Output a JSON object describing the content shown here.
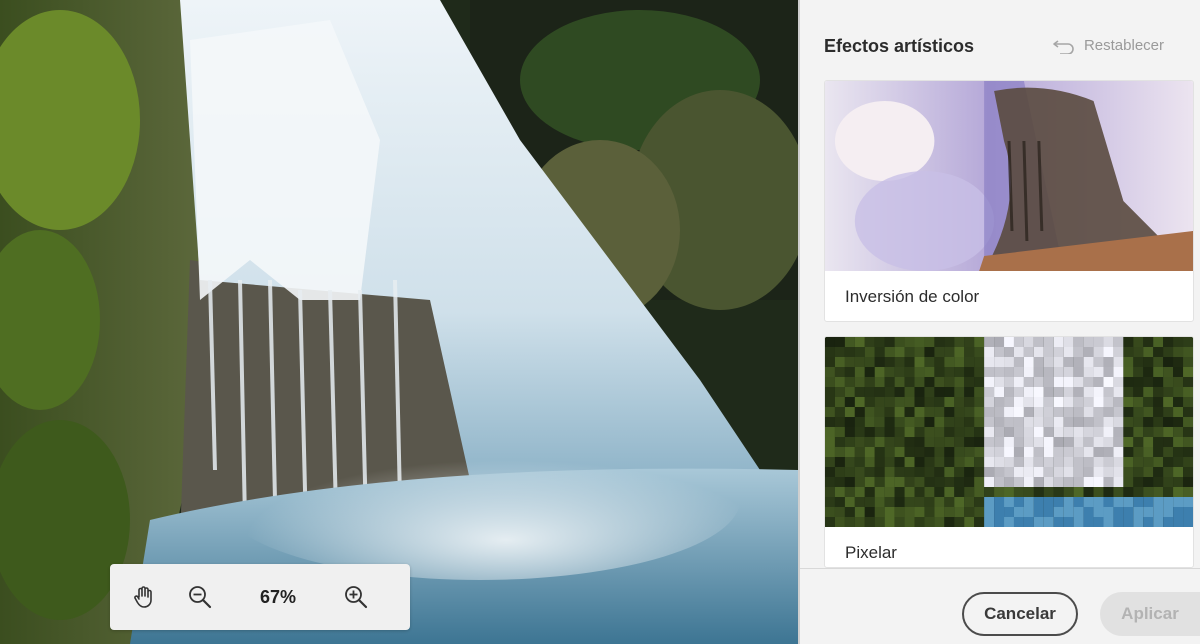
{
  "panel": {
    "title": "Efectos artísticos",
    "reset_label": "Restablecer"
  },
  "effects": [
    {
      "label": "Inversión de color",
      "icon": "color-inversion-thumbnail"
    },
    {
      "label": "Pixelar",
      "icon": "pixelate-thumbnail"
    }
  ],
  "zoom": {
    "value": "67%",
    "tools": [
      "hand-icon",
      "zoom-out-icon",
      "zoom-in-icon"
    ]
  },
  "footer": {
    "cancel_label": "Cancelar",
    "apply_label": "Aplicar"
  },
  "colors": {
    "panel_bg": "#f3f3f3",
    "apply_disabled_bg": "#e1e1e1",
    "apply_disabled_text": "#b3b3b3"
  }
}
